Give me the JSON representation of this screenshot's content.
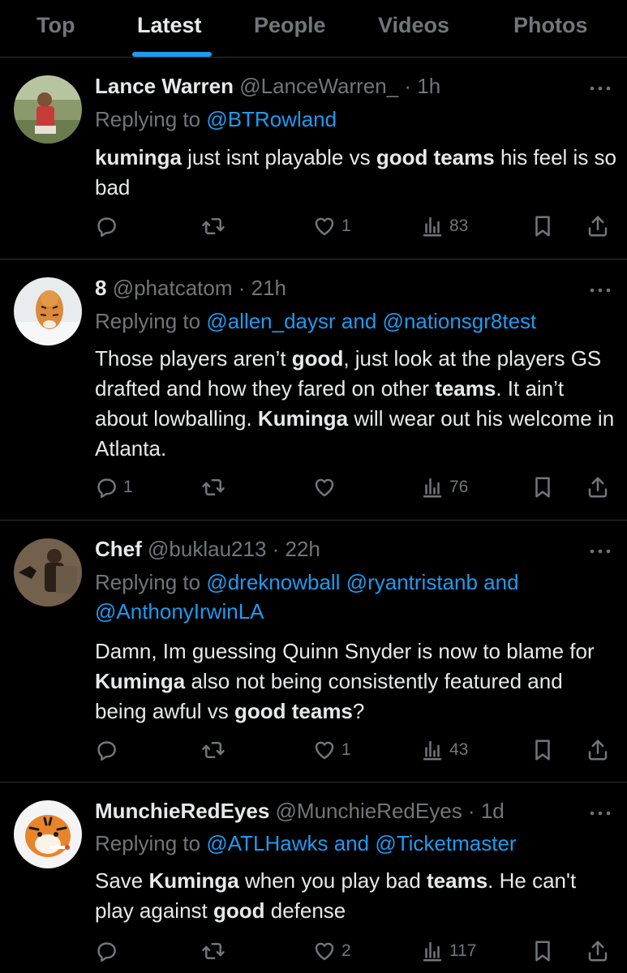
{
  "tabs": [
    {
      "label": "Top"
    },
    {
      "label": "Latest"
    },
    {
      "label": "People"
    },
    {
      "label": "Videos"
    },
    {
      "label": "Photos"
    }
  ],
  "active_tab": "Latest",
  "colors": {
    "background": "#000000",
    "text": "#e7e9ea",
    "muted": "#71767b",
    "accent": "#1d9bf0",
    "divider": "#2f3336"
  },
  "replying_prefix": "Replying to ",
  "tweets": [
    {
      "name": "Lance Warren",
      "handle": "@LanceWarren_",
      "dot": "·",
      "time": "1h",
      "mentions": [
        "@BTRowland"
      ],
      "body": [
        {
          "text": "kuminga",
          "bold": true
        },
        {
          "text": " just isnt playable vs ",
          "bold": false
        },
        {
          "text": "good teams",
          "bold": true
        },
        {
          "text": " his feel is so bad",
          "bold": false
        }
      ],
      "counts": {
        "reply": "",
        "retweet": "",
        "like": "1",
        "views": "83"
      }
    },
    {
      "name": "8",
      "handle": "@phatcatom",
      "dot": "·",
      "time": "21h",
      "mentions": [
        "@allen_daysr",
        "and",
        "@nationsgr8test"
      ],
      "body": [
        {
          "text": "Those players aren’t ",
          "bold": false
        },
        {
          "text": "good",
          "bold": true
        },
        {
          "text": ", just look at the players GS drafted and how they fared on other ",
          "bold": false
        },
        {
          "text": "teams",
          "bold": true
        },
        {
          "text": ". It ain’t about lowballing. ",
          "bold": false
        },
        {
          "text": "Kuminga",
          "bold": true
        },
        {
          "text": " will wear out his welcome in Atlanta.",
          "bold": false
        }
      ],
      "counts": {
        "reply": "1",
        "retweet": "",
        "like": "",
        "views": "76"
      }
    },
    {
      "name": "Chef",
      "handle": "@buklau213",
      "dot": "·",
      "time": "22h",
      "mentions": [
        "@dreknowball",
        "@ryantristanb",
        "and",
        "@AnthonyIrwinLA"
      ],
      "body": [
        {
          "text": "Damn, Im guessing Quinn Snyder is now to blame for ",
          "bold": false
        },
        {
          "text": "Kuminga",
          "bold": true
        },
        {
          "text": " also not being consistently featured and being awful vs ",
          "bold": false
        },
        {
          "text": "good teams",
          "bold": true
        },
        {
          "text": "?",
          "bold": false
        }
      ],
      "counts": {
        "reply": "",
        "retweet": "",
        "like": "1",
        "views": "43"
      }
    },
    {
      "name": "MunchieRedEyes",
      "handle": "@MunchieRedEyes",
      "dot": "·",
      "time": "1d",
      "mentions": [
        "@ATLHawks",
        "and",
        "@Ticketmaster"
      ],
      "body": [
        {
          "text": "Save ",
          "bold": false
        },
        {
          "text": "Kuminga",
          "bold": true
        },
        {
          "text": " when you play bad ",
          "bold": false
        },
        {
          "text": "teams",
          "bold": true
        },
        {
          "text": ". He can't play against ",
          "bold": false
        },
        {
          "text": "good",
          "bold": true
        },
        {
          "text": " defense",
          "bold": false
        }
      ],
      "counts": {
        "reply": "",
        "retweet": "",
        "like": "2",
        "views": "117"
      }
    }
  ]
}
